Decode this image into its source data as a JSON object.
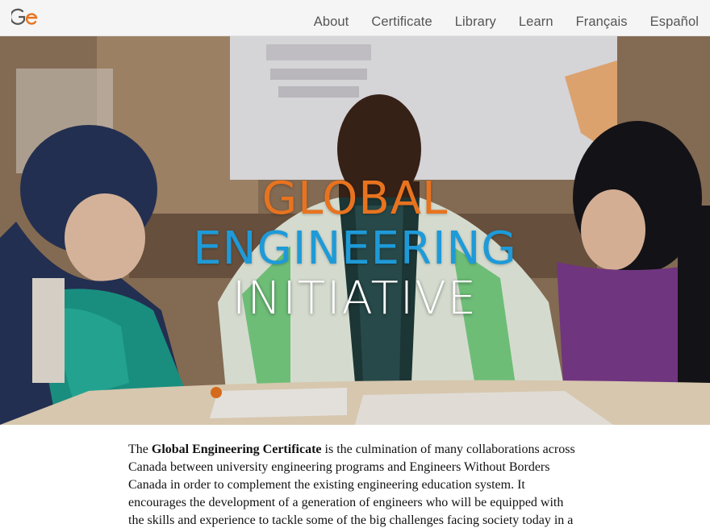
{
  "nav": {
    "logo": "logo",
    "items": [
      "About",
      "Certificate",
      "Library",
      "Learn",
      "Français",
      "Español"
    ]
  },
  "hero": {
    "title_line1": "GLOBAL",
    "title_line2": "ENGINEERING",
    "title_line3": "INITIATIVE"
  },
  "intro": {
    "prefix": "The ",
    "bold": "Global Engineering Certificate",
    "text": " is the culmination of many collaborations across Canada between university engineering programs and Engineers Without Borders Canada in order to complement the existing engineering education system. It encourages the development of a generation of engineers who will be equipped with the skills and experience to tackle some of the big challenges facing society today in a"
  },
  "colors": {
    "accent_orange": "#e8731f",
    "accent_blue": "#1e9ad8"
  }
}
